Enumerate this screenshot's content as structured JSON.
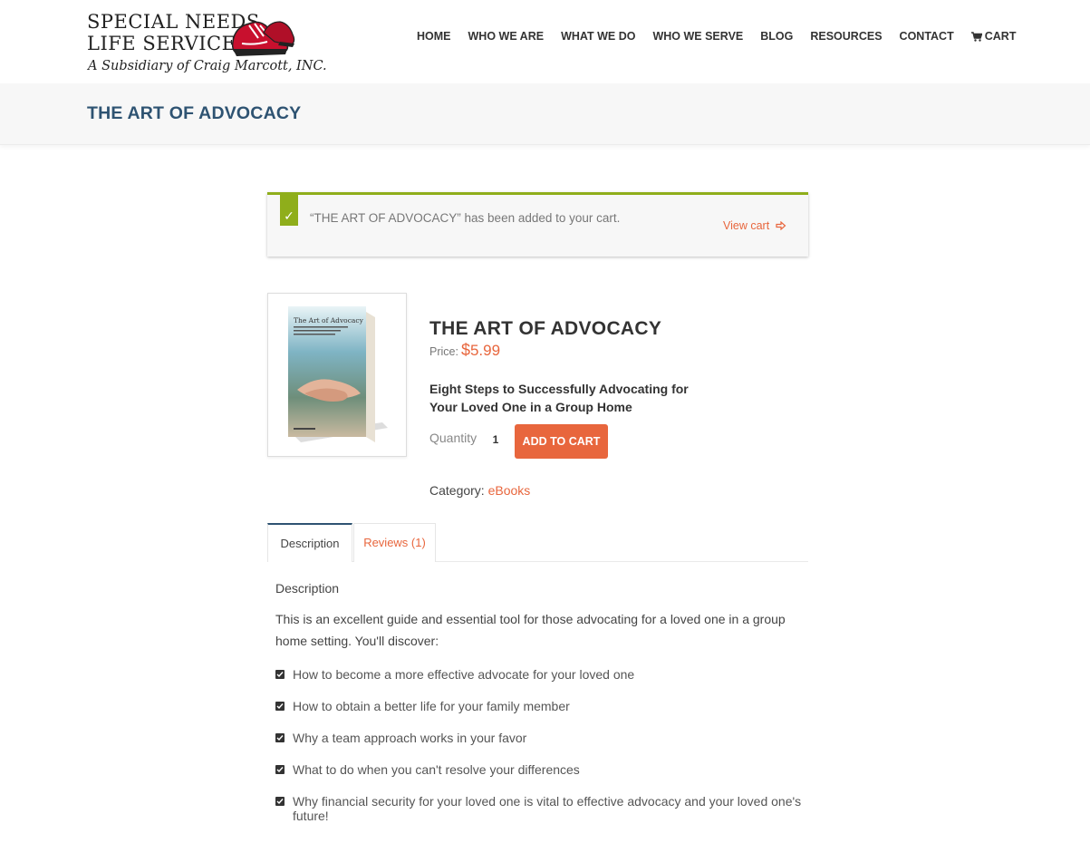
{
  "brand": {
    "name_line1": "SPECIAL NEEDS",
    "name_line2": "LIFE SERVICES",
    "subsidiary": "A Subsidiary of Craig Marcott, INC."
  },
  "nav": {
    "items": [
      {
        "label": "HOME"
      },
      {
        "label": "WHO WE ARE"
      },
      {
        "label": "WHAT WE DO"
      },
      {
        "label": "WHO WE SERVE"
      },
      {
        "label": "BLOG"
      },
      {
        "label": "RESOURCES"
      },
      {
        "label": "CONTACT"
      }
    ],
    "cart_label": "CART",
    "cart_icon": "shopping-cart-icon"
  },
  "page": {
    "title": "THE ART OF ADVOCACY"
  },
  "notice": {
    "icon": "checkmark-icon",
    "message": "“THE ART OF ADVOCACY” has been added to your cart.",
    "link_label": "View cart",
    "link_icon": "arrow-right-icon",
    "accent_color": "#8fae1b"
  },
  "product": {
    "cover_title": "The Art of Advocacy",
    "title": "THE ART OF ADVOCACY",
    "price_label": "Price:",
    "price_currency": "$",
    "price_value": "5.99",
    "subtitle": "Eight Steps to Successfully Advocating for Your Loved One in a Group Home",
    "quantity_label": "Quantity",
    "quantity_value": "1",
    "add_to_cart_label": "ADD TO CART",
    "category_label": "Category:",
    "category_value": "eBooks",
    "accent_color": "#e8663d"
  },
  "tabs": [
    {
      "label": "Description",
      "active": true
    },
    {
      "label": "Reviews (1)",
      "active": false
    }
  ],
  "description": {
    "heading": "Description",
    "body": "This is an excellent guide and essential tool for those advocating for a loved one in a group home setting. You'll discover:",
    "features": [
      "How to become a more effective advocate for your loved one",
      "How to obtain a better life for your family member",
      "Why a team approach works in your favor",
      "What to do when you can't resolve your differences",
      "Why financial security for your loved one is vital to effective advocacy and your loved one's future!"
    ]
  },
  "colors": {
    "title_blue": "#2e5372",
    "accent_orange": "#e8663d",
    "success_green": "#8fae1b"
  }
}
